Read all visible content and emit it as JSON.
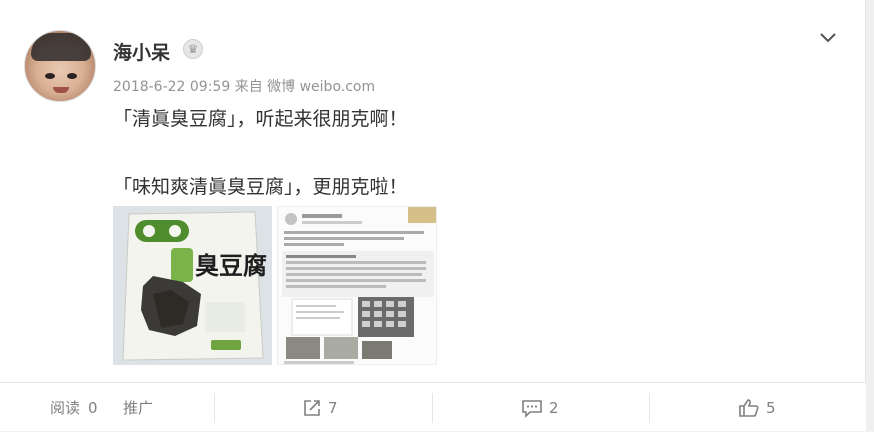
{
  "post": {
    "username": "海小呆",
    "badge_icon": "crown-icon",
    "timestamp": "2018-6-22 09:59",
    "source_prefix": "来自",
    "source": "微博 weibo.com",
    "text_line1": "「清眞臭豆腐」，听起来很朋克啊！",
    "text_line2": "「味知爽清眞臭豆腐」，更朋克啦！",
    "images": [
      {
        "icon": "tofu-package-photo",
        "package_title": "臭豆腐"
      },
      {
        "icon": "weibo-screenshot-photo"
      }
    ]
  },
  "footer": {
    "read_label": "阅读",
    "read_count": "0",
    "promote_label": "推广",
    "repost_count": "7",
    "comment_count": "2",
    "like_count": "5"
  },
  "colors": {
    "text": "#333333",
    "meta": "#939393",
    "footer_text": "#808080",
    "divider": "#e6e6e6"
  }
}
